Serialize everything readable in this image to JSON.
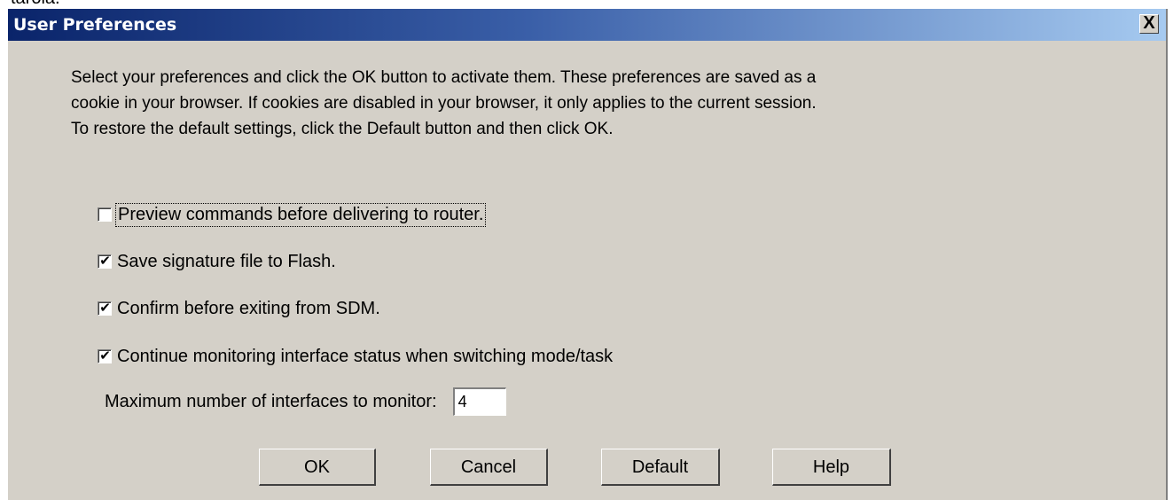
{
  "top_fragment": "tarola.",
  "window": {
    "title": "User Preferences",
    "close_glyph": "X"
  },
  "intro_lines": [
    "Select your preferences and click the OK button to activate them. These preferences are saved as a",
    "cookie in your browser.  If cookies are disabled in your browser, it only applies to the current session.",
    "To restore the default settings, click the Default button and then click OK."
  ],
  "options": [
    {
      "label": "Preview commands before delivering to router.",
      "checked": false,
      "focused": true
    },
    {
      "label": "Save signature file to Flash.",
      "checked": true,
      "focused": false
    },
    {
      "label": "Confirm before exiting from SDM.",
      "checked": true,
      "focused": false
    },
    {
      "label": "Continue monitoring interface status when switching mode/task",
      "checked": true,
      "focused": false
    }
  ],
  "max_interfaces": {
    "label": "Maximum number of interfaces to monitor:",
    "value": "4"
  },
  "buttons": {
    "ok": "OK",
    "cancel": "Cancel",
    "default": "Default",
    "help": "Help"
  },
  "check_glyph": "✔",
  "icons": {
    "close": "close-icon",
    "check": "checkmark-icon"
  },
  "colors": {
    "titlebar_start": "#0a246a",
    "titlebar_end": "#a6caf0",
    "dialog_bg": "#d4d0c8"
  }
}
